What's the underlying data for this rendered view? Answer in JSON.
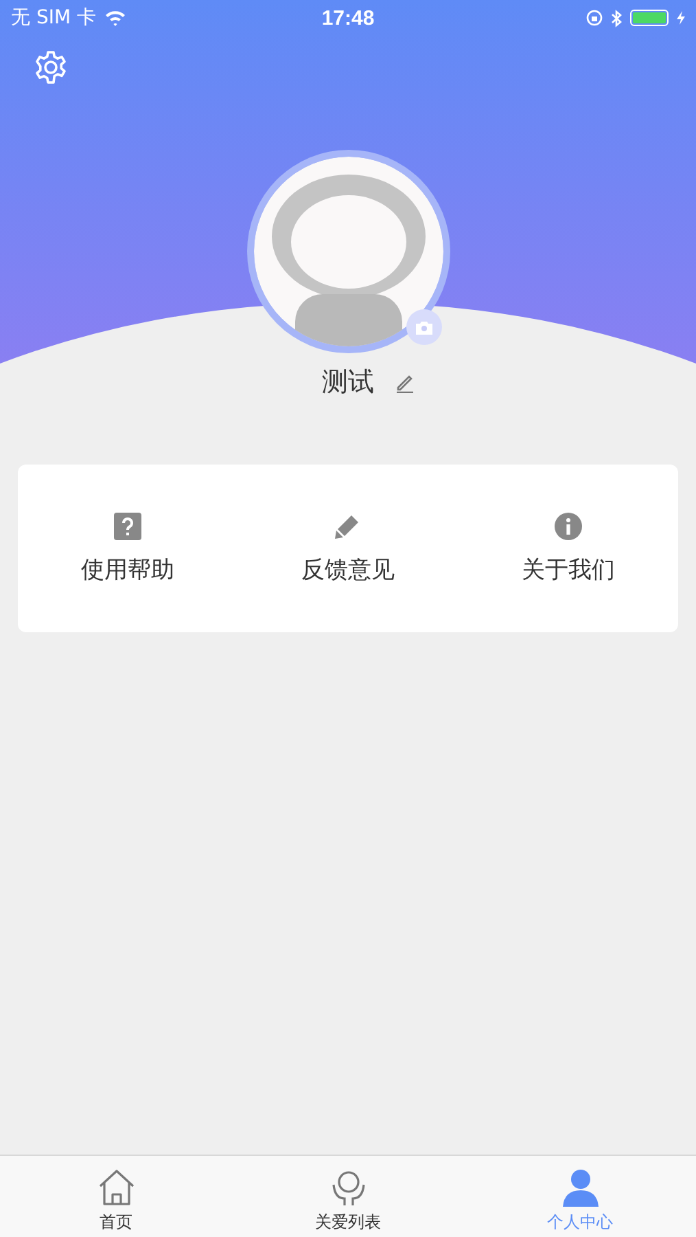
{
  "status_bar": {
    "carrier": "无 SIM 卡",
    "time": "17:48"
  },
  "profile": {
    "name": "测试"
  },
  "menu": [
    {
      "kind": "help",
      "label": "使用帮助"
    },
    {
      "kind": "feedback",
      "label": "反馈意见"
    },
    {
      "kind": "about",
      "label": "关于我们"
    }
  ],
  "tab_bar": [
    {
      "kind": "home",
      "label": "首页",
      "selected": false
    },
    {
      "kind": "care",
      "label": "关爱列表",
      "selected": false
    },
    {
      "kind": "person",
      "label": "个人中心",
      "selected": true
    }
  ]
}
